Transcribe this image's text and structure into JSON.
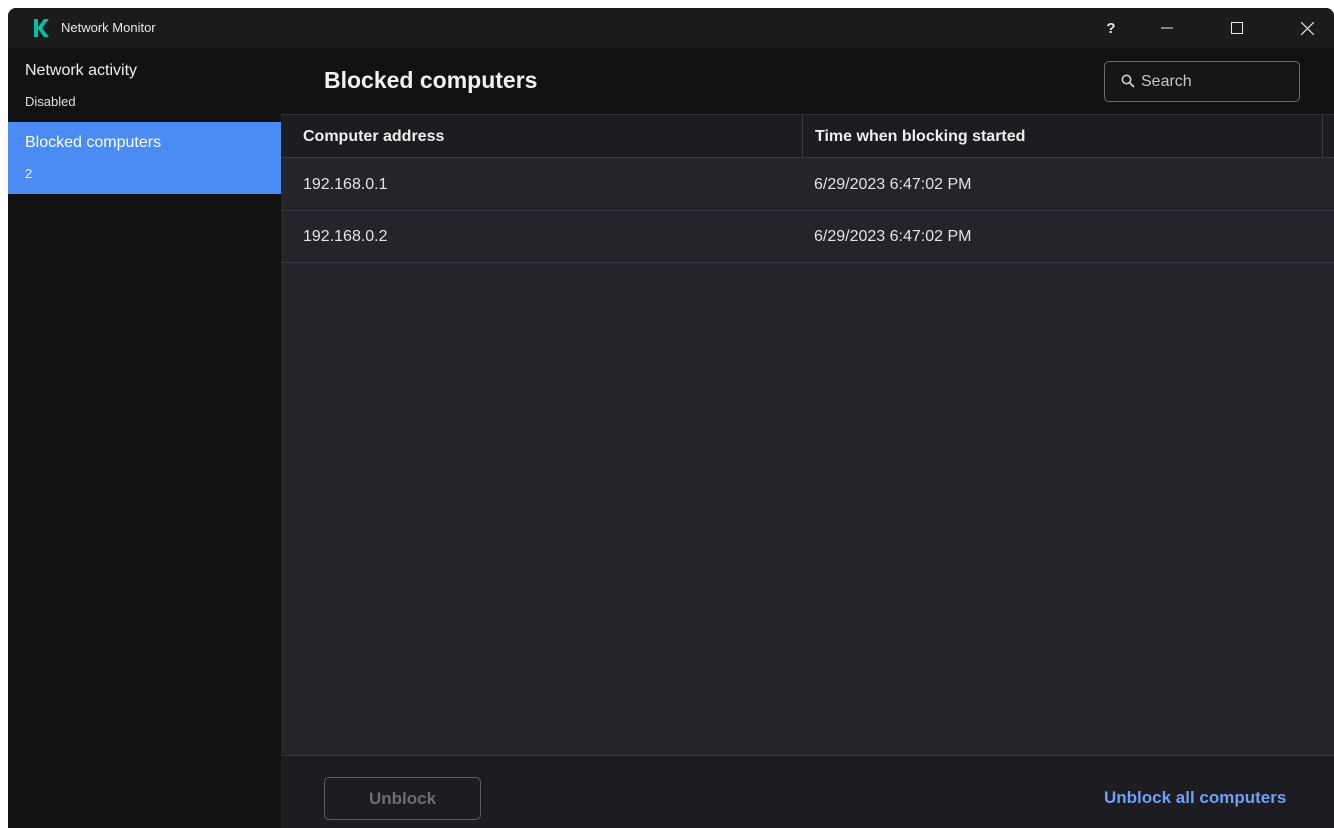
{
  "window": {
    "title": "Network Monitor",
    "controls": {
      "help": "?",
      "minimize": "–",
      "maximize": "☐",
      "close": "✕"
    }
  },
  "sidebar": {
    "items": [
      {
        "label": "Network activity",
        "sub": "Disabled"
      },
      {
        "label": "Blocked computers",
        "sub": "2"
      }
    ]
  },
  "main": {
    "title": "Blocked computers",
    "search": {
      "placeholder": "Search",
      "value": ""
    },
    "table": {
      "columns": [
        "Computer address",
        "Time when blocking started"
      ],
      "rows": [
        [
          "192.168.0.1",
          "6/29/2023 6:47:02 PM"
        ],
        [
          "192.168.0.2",
          "6/29/2023 6:47:02 PM"
        ]
      ]
    },
    "footer": {
      "unblock_label": "Unblock",
      "unblock_all_label": "Unblock all computers"
    }
  },
  "colors": {
    "accent": "#4b8bf4",
    "link": "#6fa0f5",
    "logo": "#00c2a0"
  }
}
